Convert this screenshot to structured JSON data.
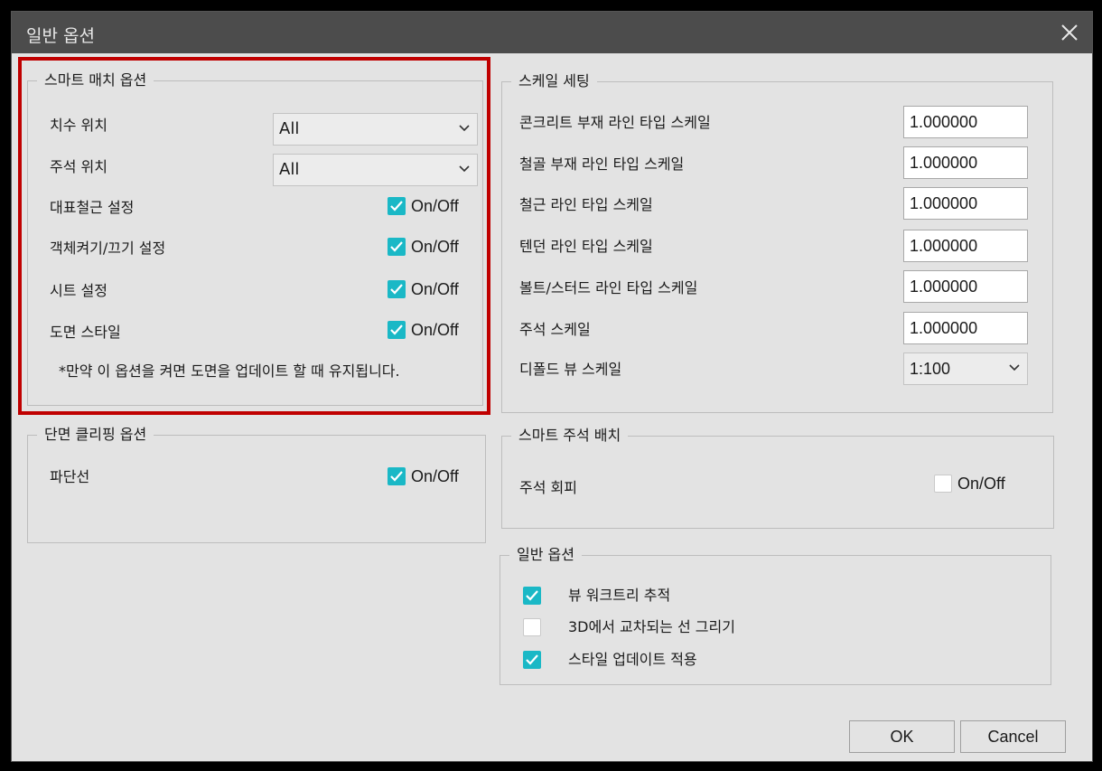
{
  "window": {
    "title": "일반 옵션"
  },
  "smart_match": {
    "title": "스마트 매치 옵션",
    "dimension_position": {
      "label": "치수 위치",
      "value": "All"
    },
    "annotation_position": {
      "label": "주석 위치",
      "value": "All"
    },
    "toggles": [
      {
        "label": "대표철근 설정",
        "text": "On/Off",
        "checked": true
      },
      {
        "label": "객체켜기/끄기 설정",
        "text": "On/Off",
        "checked": true
      },
      {
        "label": "시트 설정",
        "text": "On/Off",
        "checked": true
      },
      {
        "label": "도면 스타일",
        "text": "On/Off",
        "checked": true
      }
    ],
    "note": "*만약 이 옵션을 켜면 도면을 업데이트 할 때 유지됩니다."
  },
  "section_clipping": {
    "title": "단면 클리핑 옵션",
    "break_line": {
      "label": "파단선",
      "text": "On/Off",
      "checked": true
    }
  },
  "scale_settings": {
    "title": "스케일 세팅",
    "items": [
      {
        "label": "콘크리트 부재 라인 타입 스케일",
        "value": "1.000000"
      },
      {
        "label": "철골 부재 라인 타입 스케일",
        "value": "1.000000"
      },
      {
        "label": "철근 라인 타입 스케일",
        "value": "1.000000"
      },
      {
        "label": "텐던 라인 타입 스케일",
        "value": "1.000000"
      },
      {
        "label": "볼트/스터드 라인 타입 스케일",
        "value": "1.000000"
      },
      {
        "label": "주석 스케일",
        "value": "1.000000"
      }
    ],
    "default_view_scale": {
      "label": "디폴드 뷰 스케일",
      "value": "1:100"
    }
  },
  "smart_annotation": {
    "title": "스마트 주석 배치",
    "avoid": {
      "label": "주석 회피",
      "text": "On/Off",
      "checked": false
    }
  },
  "general": {
    "title": "일반 옵션",
    "items": [
      {
        "label": "뷰 워크트리 추적",
        "checked": true
      },
      {
        "label": "3D에서 교차되는 선 그리기",
        "checked": false
      },
      {
        "label": "스타일 업데이트 적용",
        "checked": true
      }
    ]
  },
  "buttons": {
    "ok": "OK",
    "cancel": "Cancel"
  },
  "colors": {
    "accent": "#1ab8c6",
    "highlight": "#c00000",
    "titlebar": "#4c4c4c",
    "background": "#e3e3e3"
  }
}
